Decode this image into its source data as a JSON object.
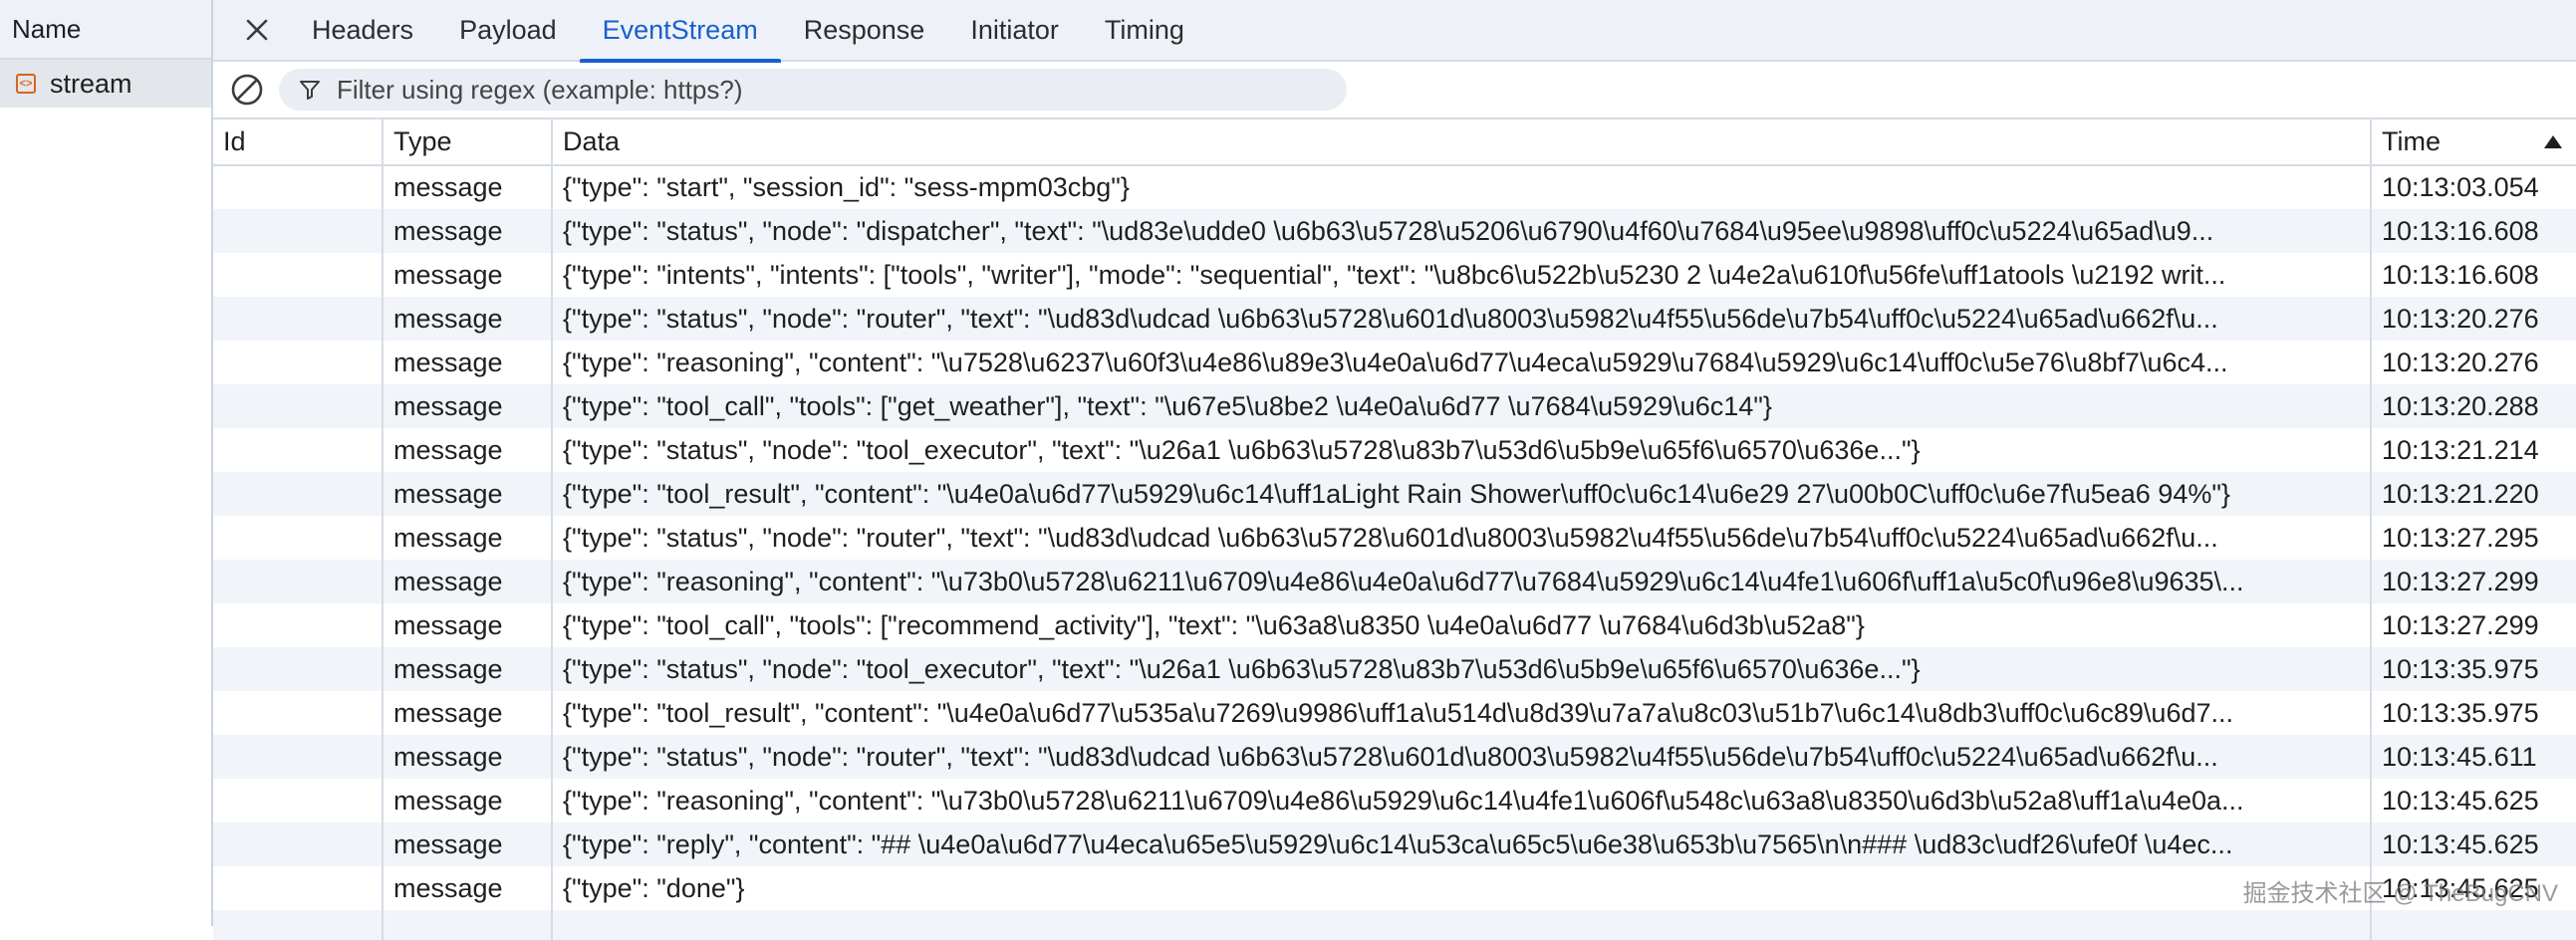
{
  "left_pane": {
    "header": "Name",
    "request": {
      "name": "stream",
      "icon": "event-stream-icon"
    }
  },
  "tabs": {
    "close_icon": "close-icon",
    "items": [
      {
        "label": "Headers"
      },
      {
        "label": "Payload"
      },
      {
        "label": "EventStream",
        "active": true
      },
      {
        "label": "Response"
      },
      {
        "label": "Initiator"
      },
      {
        "label": "Timing"
      }
    ]
  },
  "filter": {
    "clear_icon": "clear-icon",
    "funnel_icon": "filter-icon",
    "placeholder": "Filter using regex (example: https?)"
  },
  "table": {
    "headers": {
      "id": "Id",
      "type": "Type",
      "data": "Data",
      "time": "Time"
    },
    "sort": "Time ascending",
    "rows": [
      {
        "id": "",
        "type": "message",
        "data": "{\"type\": \"start\", \"session_id\": \"sess-mpm03cbg\"}",
        "time": "10:13:03.054"
      },
      {
        "id": "",
        "type": "message",
        "data": "{\"type\": \"status\", \"node\": \"dispatcher\", \"text\": \"\\ud83e\\udde0 \\u6b63\\u5728\\u5206\\u6790\\u4f60\\u7684\\u95ee\\u9898\\uff0c\\u5224\\u65ad\\u9...",
        "time": "10:13:16.608"
      },
      {
        "id": "",
        "type": "message",
        "data": "{\"type\": \"intents\", \"intents\": [\"tools\", \"writer\"], \"mode\": \"sequential\", \"text\": \"\\u8bc6\\u522b\\u5230 2 \\u4e2a\\u610f\\u56fe\\uff1atools \\u2192 writ...",
        "time": "10:13:16.608"
      },
      {
        "id": "",
        "type": "message",
        "data": "{\"type\": \"status\", \"node\": \"router\", \"text\": \"\\ud83d\\udcad \\u6b63\\u5728\\u601d\\u8003\\u5982\\u4f55\\u56de\\u7b54\\uff0c\\u5224\\u65ad\\u662f\\u...",
        "time": "10:13:20.276"
      },
      {
        "id": "",
        "type": "message",
        "data": "{\"type\": \"reasoning\", \"content\": \"\\u7528\\u6237\\u60f3\\u4e86\\u89e3\\u4e0a\\u6d77\\u4eca\\u5929\\u7684\\u5929\\u6c14\\uff0c\\u5e76\\u8bf7\\u6c4...",
        "time": "10:13:20.276"
      },
      {
        "id": "",
        "type": "message",
        "data": "{\"type\": \"tool_call\", \"tools\": [\"get_weather\"], \"text\": \"\\u67e5\\u8be2 \\u4e0a\\u6d77 \\u7684\\u5929\\u6c14\"}",
        "time": "10:13:20.288"
      },
      {
        "id": "",
        "type": "message",
        "data": "{\"type\": \"status\", \"node\": \"tool_executor\", \"text\": \"\\u26a1 \\u6b63\\u5728\\u83b7\\u53d6\\u5b9e\\u65f6\\u6570\\u636e...\"}",
        "time": "10:13:21.214"
      },
      {
        "id": "",
        "type": "message",
        "data": "{\"type\": \"tool_result\", \"content\": \"\\u4e0a\\u6d77\\u5929\\u6c14\\uff1aLight Rain Shower\\uff0c\\u6c14\\u6e29 27\\u00b0C\\uff0c\\u6e7f\\u5ea6 94%\"}",
        "time": "10:13:21.220"
      },
      {
        "id": "",
        "type": "message",
        "data": "{\"type\": \"status\", \"node\": \"router\", \"text\": \"\\ud83d\\udcad \\u6b63\\u5728\\u601d\\u8003\\u5982\\u4f55\\u56de\\u7b54\\uff0c\\u5224\\u65ad\\u662f\\u...",
        "time": "10:13:27.295"
      },
      {
        "id": "",
        "type": "message",
        "data": "{\"type\": \"reasoning\", \"content\": \"\\u73b0\\u5728\\u6211\\u6709\\u4e86\\u4e0a\\u6d77\\u7684\\u5929\\u6c14\\u4fe1\\u606f\\uff1a\\u5c0f\\u96e8\\u9635\\...",
        "time": "10:13:27.299"
      },
      {
        "id": "",
        "type": "message",
        "data": "{\"type\": \"tool_call\", \"tools\": [\"recommend_activity\"], \"text\": \"\\u63a8\\u8350 \\u4e0a\\u6d77 \\u7684\\u6d3b\\u52a8\"}",
        "time": "10:13:27.299"
      },
      {
        "id": "",
        "type": "message",
        "data": "{\"type\": \"status\", \"node\": \"tool_executor\", \"text\": \"\\u26a1 \\u6b63\\u5728\\u83b7\\u53d6\\u5b9e\\u65f6\\u6570\\u636e...\"}",
        "time": "10:13:35.975"
      },
      {
        "id": "",
        "type": "message",
        "data": "{\"type\": \"tool_result\", \"content\": \"\\u4e0a\\u6d77\\u535a\\u7269\\u9986\\uff1a\\u514d\\u8d39\\u7a7a\\u8c03\\u51b7\\u6c14\\u8db3\\uff0c\\u6c89\\u6d7...",
        "time": "10:13:35.975"
      },
      {
        "id": "",
        "type": "message",
        "data": "{\"type\": \"status\", \"node\": \"router\", \"text\": \"\\ud83d\\udcad \\u6b63\\u5728\\u601d\\u8003\\u5982\\u4f55\\u56de\\u7b54\\uff0c\\u5224\\u65ad\\u662f\\u...",
        "time": "10:13:45.611"
      },
      {
        "id": "",
        "type": "message",
        "data": "{\"type\": \"reasoning\", \"content\": \"\\u73b0\\u5728\\u6211\\u6709\\u4e86\\u5929\\u6c14\\u4fe1\\u606f\\u548c\\u63a8\\u8350\\u6d3b\\u52a8\\uff1a\\u4e0a...",
        "time": "10:13:45.625"
      },
      {
        "id": "",
        "type": "message",
        "data": "{\"type\": \"reply\", \"content\": \"## \\u4e0a\\u6d77\\u4eca\\u65e5\\u5929\\u6c14\\u53ca\\u65c5\\u6e38\\u653b\\u7565\\n\\n### \\ud83c\\udf26\\ufe0f \\u4ec...",
        "time": "10:13:45.625"
      },
      {
        "id": "",
        "type": "message",
        "data": "{\"type\": \"done\"}",
        "time": "10:13:45.625"
      }
    ]
  },
  "watermark": "掘金技术社区 @ TheBugCNV",
  "colors": {
    "accent": "#1a5fcf",
    "header_bg": "#eef2f8",
    "row_alt": "#f1f4f9",
    "border": "#d6dce6",
    "request_icon": "#d9641e"
  }
}
